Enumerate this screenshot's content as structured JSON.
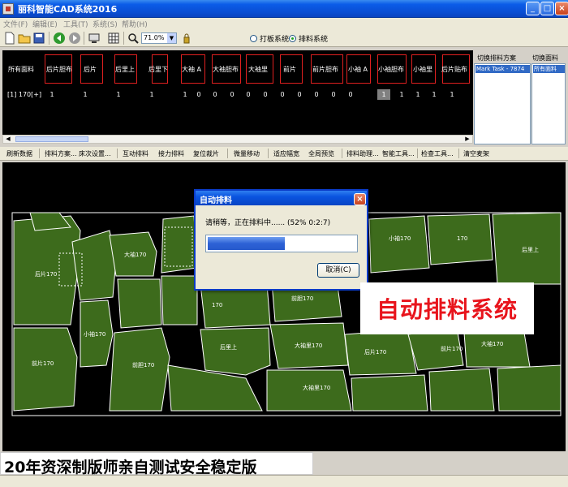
{
  "window": {
    "title": "丽科智能CAD系统2016",
    "min": "_",
    "max": "□",
    "close": "×"
  },
  "menu": [
    "文件(F)",
    "编辑(E)",
    "工具(T)",
    "系统(S)",
    "帮助(H)"
  ],
  "toolbar": {
    "zoom": "71.0%",
    "mode_pattern": "打板系统",
    "mode_marker": "排料系统"
  },
  "pieces": {
    "headers": [
      "所有面料",
      "后片胆布",
      "后片",
      "后里上",
      "后里下",
      "大袖 A",
      "大袖胆布",
      "大袖里",
      "前片",
      "前片胆布",
      "小袖 A",
      "小袖胆布",
      "小袖里",
      "后片贴布"
    ],
    "row_label": "[1] 170[+]",
    "row_values": [
      "1",
      "1",
      "1",
      "1",
      "1",
      "0",
      "0",
      "0",
      "0",
      "0",
      "0",
      "0",
      "0",
      "0",
      "0",
      "1",
      "1",
      "1",
      "1",
      "1"
    ],
    "selected_index": 15
  },
  "right_panel": {
    "scheme_header": "切换排料方案",
    "fabric_header": "切换面料",
    "scheme_selected": "Mark Task - 7874",
    "fabric_selected": "所有面料"
  },
  "function_tabs": [
    "刷新数据",
    "排料方案...",
    "床次设置...",
    "互动排料",
    "接力排料",
    "复位裁片",
    "微量移动",
    "适应幅宽",
    "全局预览",
    "排料助理...",
    "智能工具...",
    "检查工具...",
    "清空麦架"
  ],
  "dialog": {
    "title": "自动排料",
    "status": "请稍等，正在排料中......  (52%  0:2:7)",
    "progress": 0.52,
    "cancel": "取消(C)"
  },
  "overlay": {
    "promo": "自动排料系统",
    "banner": "20年资深制版师亲自测试安全稳定版"
  },
  "marker_labels": [
    "后片170",
    "前片170",
    "大袖170",
    "小袖170",
    "170",
    "后里上",
    "前胆170",
    "大袖里170"
  ],
  "colors": {
    "piece_fill": "#3d6b1c",
    "piece_stroke": "#ffffff",
    "canvas": "#000000",
    "accent": "#e8141c"
  }
}
